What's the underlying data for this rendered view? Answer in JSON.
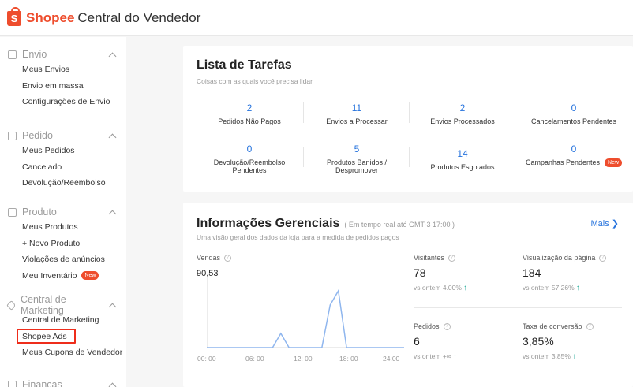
{
  "header": {
    "brand": "Shopee",
    "title_rest": "Central do Vendedor",
    "logo_letter": "S"
  },
  "sidebar": {
    "sections": [
      {
        "icon": "truck-icon",
        "title": "Envio",
        "items": [
          "Meus Envios",
          "Envio em massa",
          "Configurações de Envio"
        ]
      },
      {
        "icon": "clipboard-icon",
        "title": "Pedido",
        "items": [
          "Meus Pedidos",
          "Cancelado",
          "Devolução/Reembolso"
        ]
      },
      {
        "icon": "box-icon",
        "title": "Produto",
        "items": [
          "Meus Produtos",
          "+ Novo Produto",
          "Violações de anúncios",
          "Meu Inventário"
        ]
      },
      {
        "icon": "tag-icon",
        "title": "Central de Marketing",
        "items": [
          "Central de Marketing",
          "Shopee Ads",
          "Meus Cupons de Vendedor"
        ]
      },
      {
        "icon": "wallet-icon",
        "title": "Finanças",
        "items": []
      }
    ],
    "new_badge": "New"
  },
  "tasks": {
    "title": "Lista de Tarefas",
    "subtitle": "Coisas com as quais você precisa lidar",
    "items": [
      {
        "value": "2",
        "label": "Pedidos Não Pagos"
      },
      {
        "value": "11",
        "label": "Envios a Processar"
      },
      {
        "value": "2",
        "label": "Envios Processados"
      },
      {
        "value": "0",
        "label": "Cancelamentos Pendentes"
      },
      {
        "value": "0",
        "label": "Devolução/Reembolso Pendentes"
      },
      {
        "value": "5",
        "label": "Produtos Banidos / Despromover"
      },
      {
        "value": "14",
        "label": "Produtos Esgotados"
      },
      {
        "value": "0",
        "label": "Campanhas Pendentes"
      }
    ],
    "new_badge": "New"
  },
  "insights": {
    "title": "Informações Gerenciais",
    "realtime": "( Em tempo real até GMT-3 17:00 )",
    "subtitle": "Uma visão geral dos dados da loja para a medida de pedidos pagos",
    "more": "Mais",
    "sales_label": "Vendas",
    "sales_value": "90,53",
    "metrics": [
      {
        "label": "Visitantes",
        "value": "78",
        "vs": "vs ontem 4.00%"
      },
      {
        "label": "Visualização da página",
        "value": "184",
        "vs": "vs ontem 57.26%"
      },
      {
        "label": "Pedidos",
        "value": "6",
        "vs": "vs ontem +∞"
      },
      {
        "label": "Taxa de conversão",
        "value": "3,85%",
        "vs": "vs ontem 3.85%"
      }
    ],
    "accent": "#2673dd",
    "up_color": "#26aa99"
  },
  "chart_data": {
    "type": "line",
    "x_tick_labels": [
      "00: 00",
      "06: 00",
      "12: 00",
      "18: 00",
      "24:00"
    ],
    "x": [
      0,
      1,
      2,
      3,
      4,
      5,
      6,
      7,
      8,
      9,
      10,
      11,
      12,
      13,
      14,
      15,
      16,
      17,
      18,
      19,
      20,
      21,
      22,
      23,
      24
    ],
    "values": [
      0,
      0,
      0,
      0,
      0,
      0,
      0,
      0,
      0,
      1,
      0,
      0,
      0,
      0,
      0,
      3,
      4,
      0,
      0,
      0,
      0,
      0,
      0,
      0,
      0
    ],
    "xlim": [
      0,
      24
    ],
    "ylim": [
      0,
      5
    ],
    "line_color": "#8fb6ee"
  }
}
